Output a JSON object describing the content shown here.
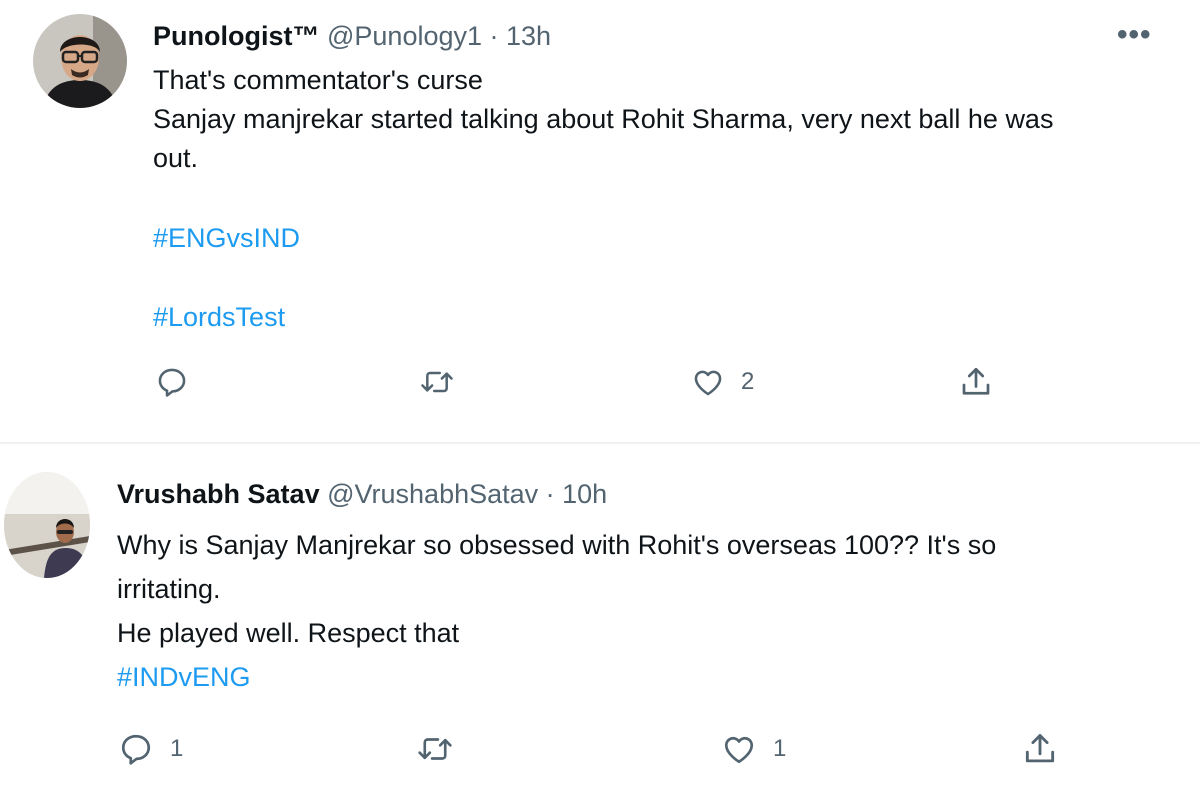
{
  "tweets": [
    {
      "display_name": "Punologist™",
      "handle": "@Punology1",
      "separator": " · ",
      "time": "13h",
      "more_icon": "more-horizontal-icon",
      "lines": [
        "That's commentator's curse",
        "Sanjay manjrekar started talking about Rohit Sharma, very next ball he was",
        "out."
      ],
      "hashtags": [
        "#ENGvsIND",
        "#LordsTest"
      ],
      "actions": {
        "reply": {
          "icon": "reply-icon",
          "count": ""
        },
        "retweet": {
          "icon": "retweet-icon",
          "count": ""
        },
        "like": {
          "icon": "like-icon",
          "count": "2"
        },
        "share": {
          "icon": "share-icon",
          "count": ""
        }
      }
    },
    {
      "display_name": "Vrushabh Satav",
      "handle": "@VrushabhSatav",
      "separator": " · ",
      "time": "10h",
      "lines": [
        "Why is Sanjay Manjrekar so obsessed with Rohit's overseas 100?? It's so",
        "irritating.",
        "He played well. Respect that"
      ],
      "hashtags": [
        "#INDvENG"
      ],
      "actions": {
        "reply": {
          "icon": "reply-icon",
          "count": "1"
        },
        "retweet": {
          "icon": "retweet-icon",
          "count": ""
        },
        "like": {
          "icon": "like-icon",
          "count": "1"
        },
        "share": {
          "icon": "share-icon",
          "count": ""
        }
      }
    }
  ],
  "colors": {
    "hashtag": "#1d9bf0",
    "meta": "#536471",
    "text": "#0f1419",
    "divider": "#eef0f2"
  }
}
